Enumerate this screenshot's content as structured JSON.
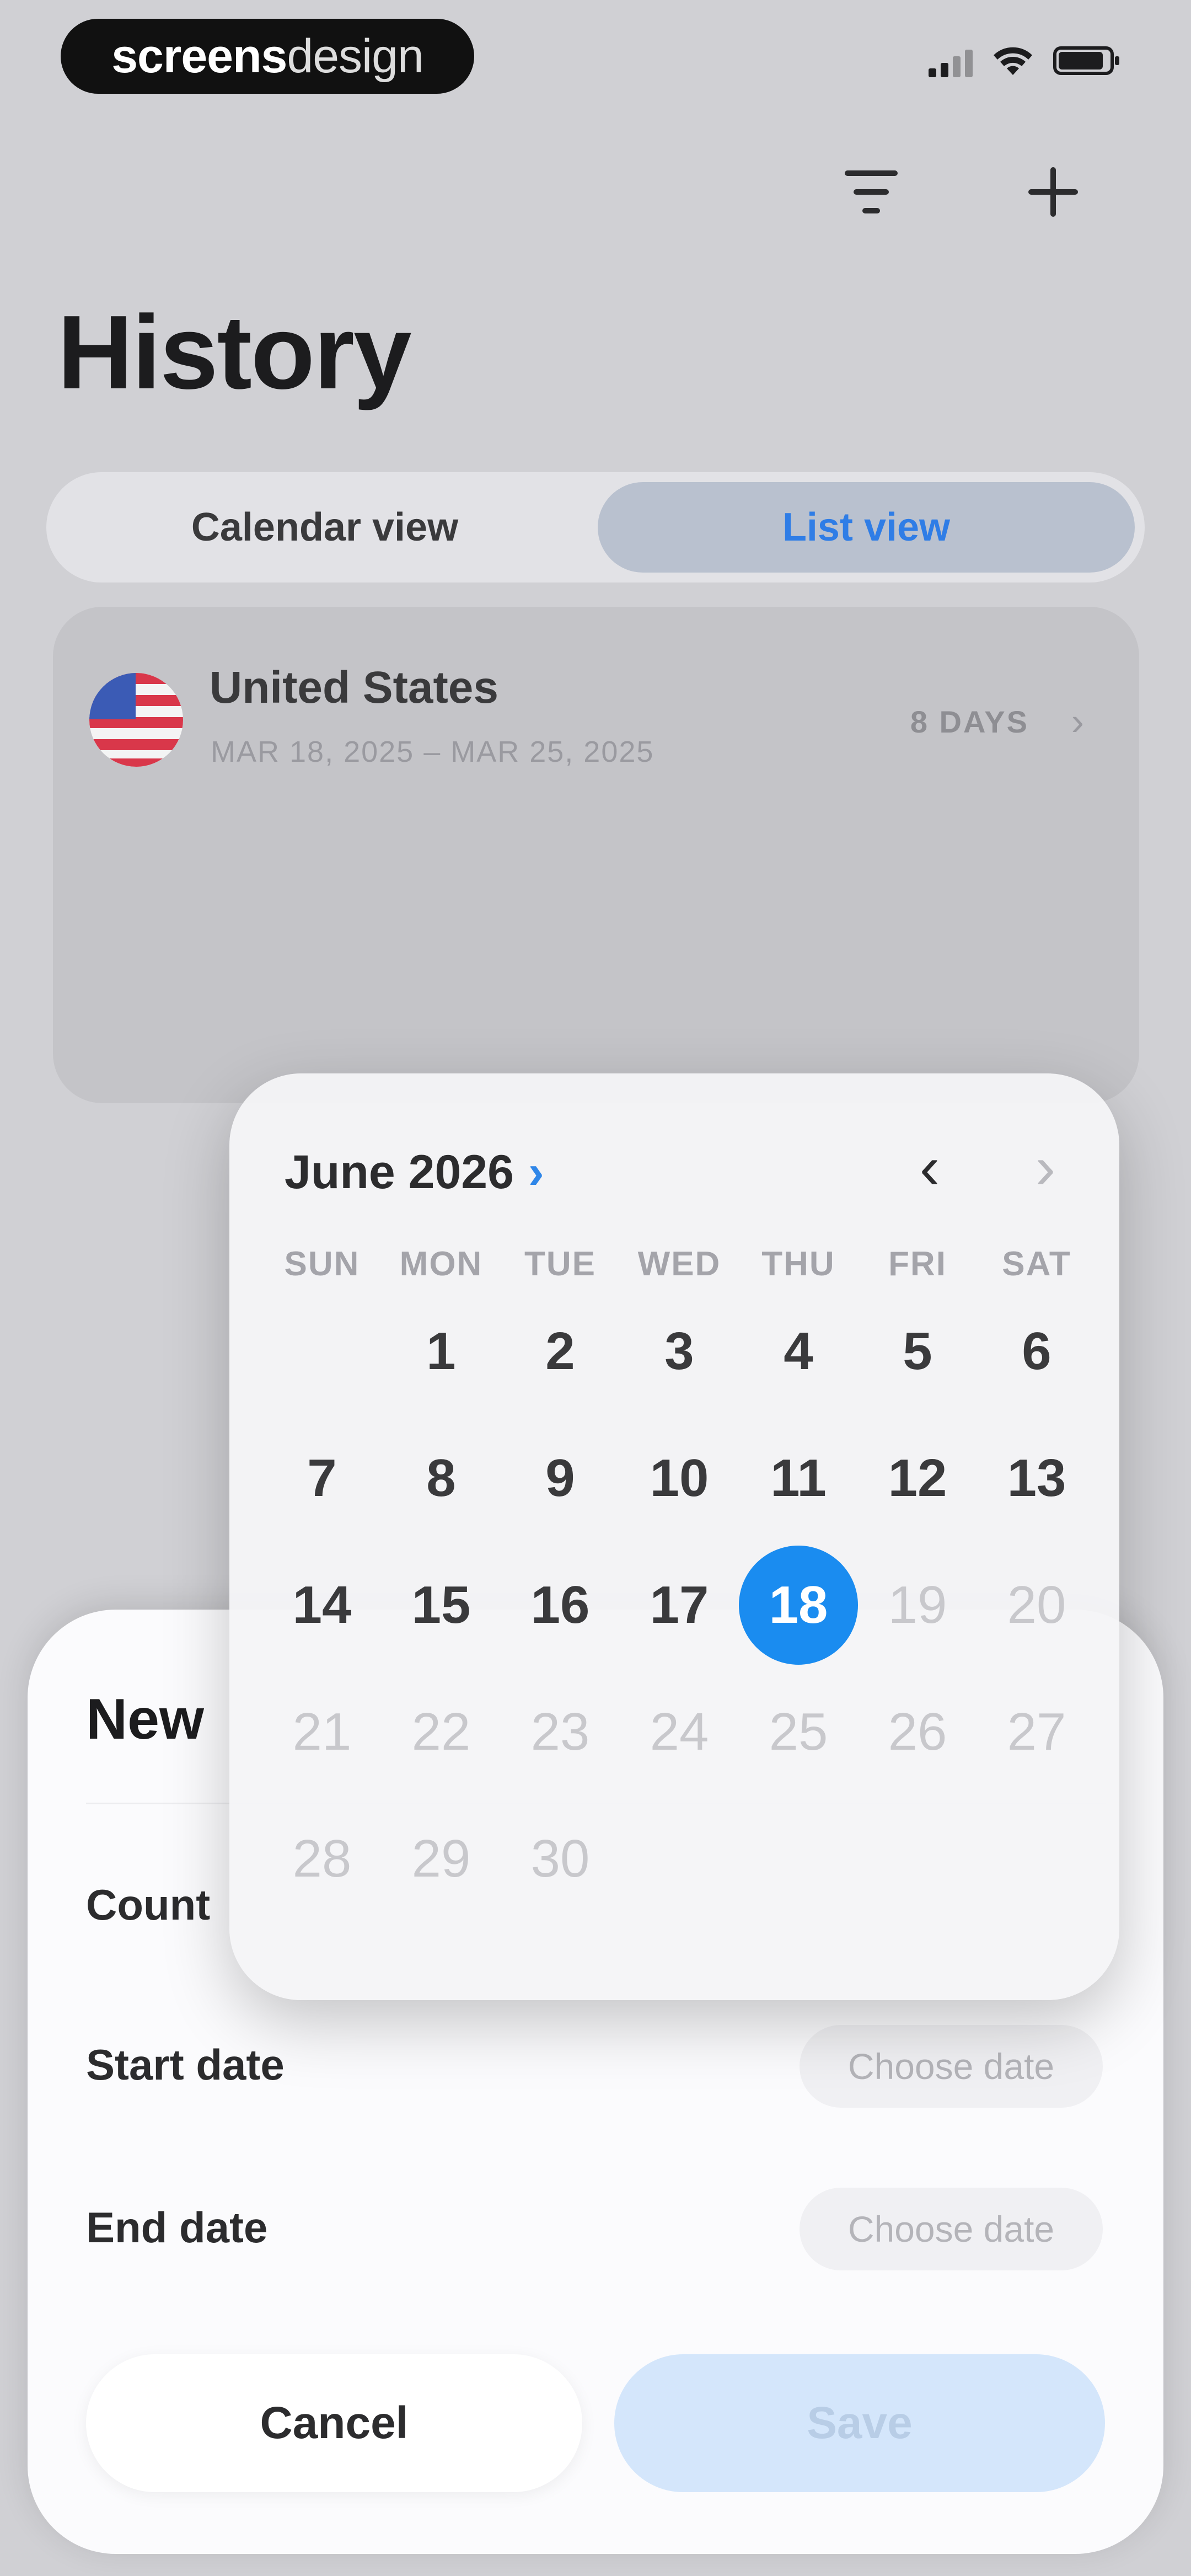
{
  "watermark": {
    "bold": "screens",
    "light": "design"
  },
  "header": {
    "title": "History",
    "filter_icon": "filter-icon",
    "add_icon": "plus-icon"
  },
  "tabs": [
    {
      "label": "Calendar view"
    },
    {
      "label": "List view",
      "selected": true
    }
  ],
  "trip": {
    "country": "United States",
    "dates": "MAR 18, 2025 – MAR 25, 2025",
    "duration": "8 DAYS"
  },
  "sheet": {
    "title": "New",
    "country_label": "Count",
    "start_label": "Start date",
    "start_placeholder": "Choose date",
    "end_label": "End date",
    "end_placeholder": "Choose date",
    "cancel": "Cancel",
    "save": "Save"
  },
  "calendar": {
    "month": "June 2026",
    "weekdays": [
      "SUN",
      "MON",
      "TUE",
      "WED",
      "THU",
      "FRI",
      "SAT"
    ],
    "first_weekday_index": 1,
    "days_in_month": 30,
    "selected": 18
  },
  "colors": {
    "accent": "#1a8cf0",
    "selected_tab_bg": "#b9c1cf"
  }
}
